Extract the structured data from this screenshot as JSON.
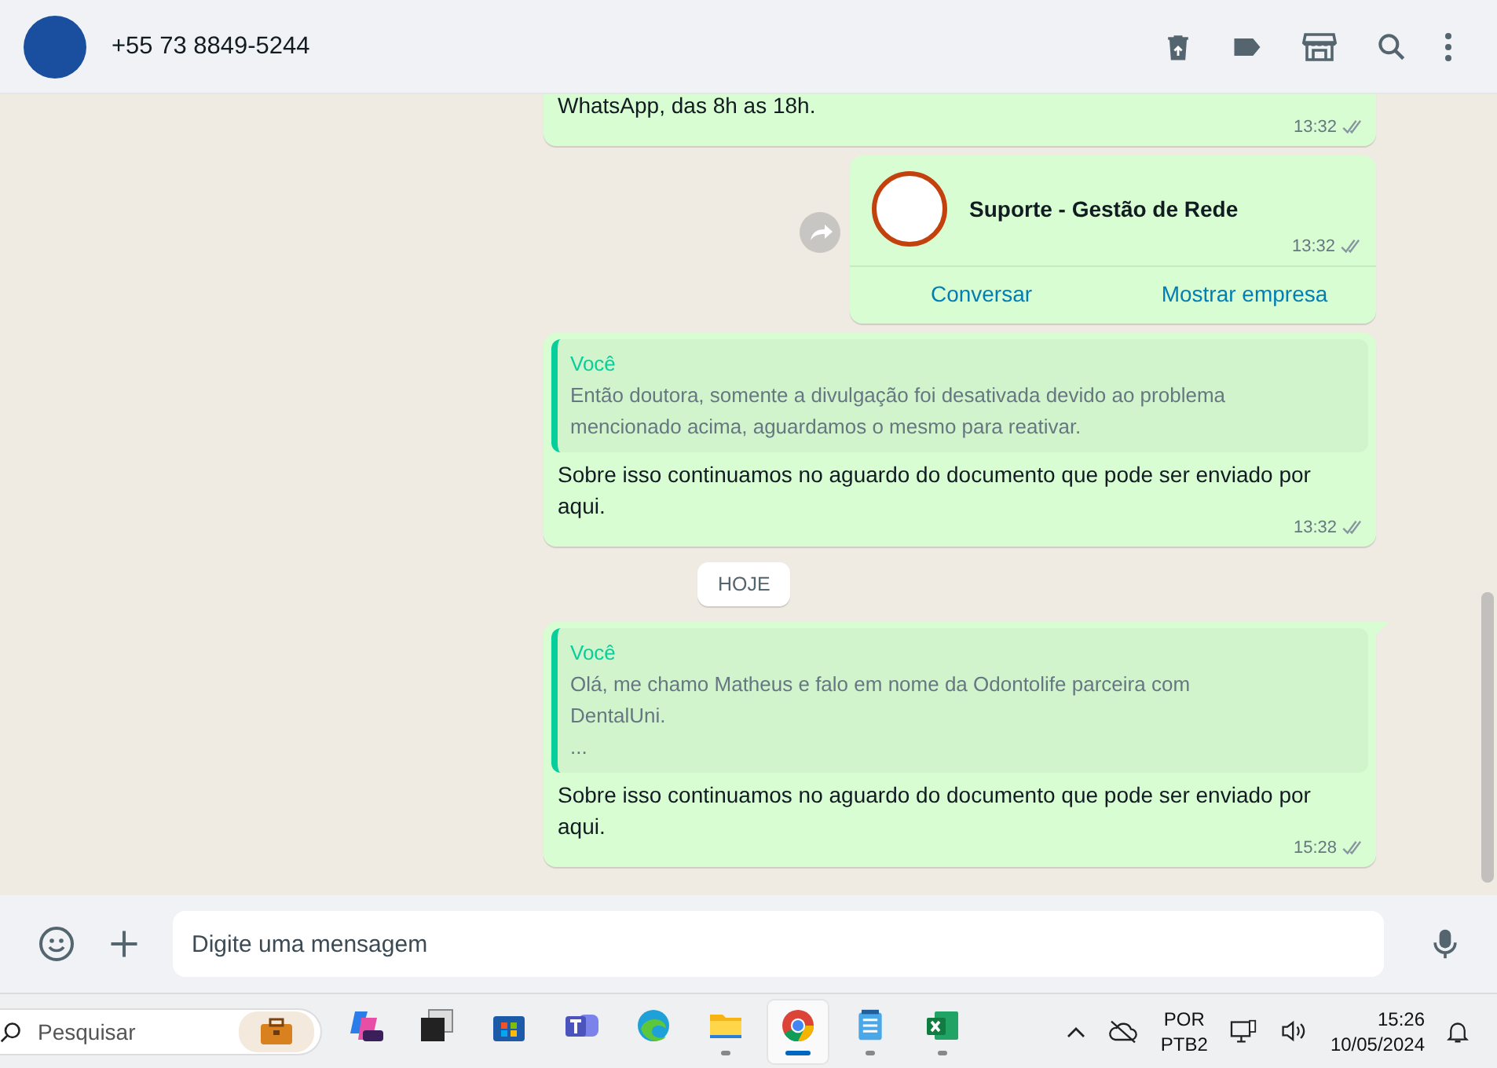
{
  "header": {
    "contact": "+55 73 8849-5244"
  },
  "messages": [
    {
      "kind": "text",
      "text": "WhatsApp, das 8h as 18h.",
      "time": "13:32",
      "read": false
    },
    {
      "kind": "contact",
      "name": "Suporte - Gestão de Rede",
      "time": "13:32",
      "read": false,
      "actions": [
        "Conversar",
        "Mostrar empresa"
      ]
    },
    {
      "kind": "reply",
      "quote_author": "Você",
      "quote_text": "Então doutora, somente a divulgação foi desativada devido ao problema mencionado acima, aguardamos o mesmo para reativar.",
      "text": "Sobre isso continuamos no aguardo do documento que pode ser enviado por aqui.",
      "time": "13:32",
      "read": false,
      "tail": false
    },
    {
      "kind": "date",
      "text": "HOJE"
    },
    {
      "kind": "reply",
      "quote_author": "Você",
      "quote_text": "Olá, me chamo Matheus e falo em nome da Odontolife parceira com DentalUni.\n...",
      "text": "Sobre isso continuamos no aguardo do documento que pode ser enviado por aqui.",
      "time": "15:28",
      "read": false,
      "tail": true
    }
  ],
  "composer": {
    "placeholder": "Digite uma mensagem"
  },
  "taskbar": {
    "search_placeholder": "Pesquisar",
    "apps": [
      {
        "kind": "copilot",
        "running": false,
        "selected": false
      },
      {
        "kind": "window",
        "running": false,
        "selected": false
      },
      {
        "kind": "store",
        "running": false,
        "selected": false
      },
      {
        "kind": "teams",
        "running": false,
        "selected": false
      },
      {
        "kind": "edge",
        "running": false,
        "selected": false
      },
      {
        "kind": "files",
        "running": true,
        "selected": false
      },
      {
        "kind": "chrome",
        "running": true,
        "selected": true
      },
      {
        "kind": "notepad",
        "running": true,
        "selected": false
      },
      {
        "kind": "excel",
        "running": true,
        "selected": false
      }
    ],
    "language": "POR",
    "layout": "PTB2",
    "time": "15:26",
    "date": "10/05/2024"
  }
}
